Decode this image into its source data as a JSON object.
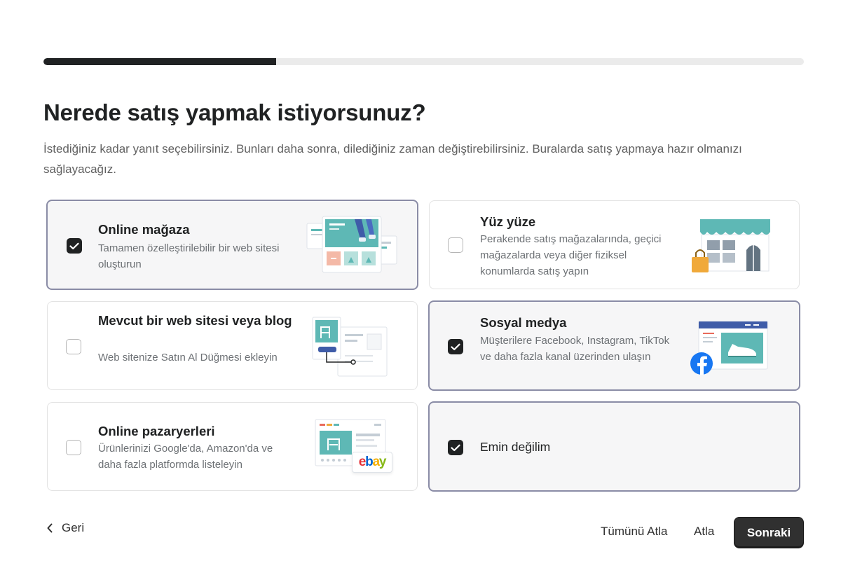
{
  "progress": {
    "fraction": 0.306
  },
  "header": {
    "title": "Nerede satış yapmak istiyorsunuz?",
    "subtitle": "İstediğiniz kadar yanıt seçebilirsiniz. Bunları daha sonra, dilediğiniz zaman değiştirebilirsiniz. Buralarda satış yapmaya hazır olmanızı sağlayacağız."
  },
  "options": {
    "online_store": {
      "title": "Online mağaza",
      "description": "Tamamen özelleştirilebilir bir web sitesi oluşturun",
      "selected": true,
      "icon": "online-store-illustration"
    },
    "in_person": {
      "title": "Yüz yüze",
      "description": "Perakende satış mağazalarında, geçici mağazalarda veya diğer fiziksel konumlarda satış yapın",
      "selected": false,
      "icon": "storefront-illustration"
    },
    "existing_site": {
      "title": "Mevcut bir web sitesi veya blog",
      "description": "Web sitenize Satın Al Düğmesi ekleyin",
      "selected": false,
      "icon": "buy-button-illustration"
    },
    "social_media": {
      "title": "Sosyal medya",
      "description": "Müşterilere Facebook, Instagram, TikTok ve daha fazla kanal üzerinden ulaşın",
      "selected": true,
      "icon": "facebook-shop-illustration"
    },
    "marketplaces": {
      "title": "Online pazaryerleri",
      "description": "Ürünlerinizi Google'da, Amazon'da ve daha fazla platformda listeleyin",
      "selected": false,
      "icon": "marketplace-illustration",
      "badge": "ebay"
    },
    "not_sure": {
      "title": "Emin değilim",
      "selected": true
    }
  },
  "footer": {
    "back_label": "Geri",
    "skip_all_label": "Tümünü Atla",
    "skip_label": "Atla",
    "next_label": "Sonraki"
  },
  "colors": {
    "primary": "#303030",
    "selected_border": "#8a8ca6",
    "selected_bg": "#f6f6f7",
    "teal": "#5eb8b5",
    "facebook": "#1877f2"
  }
}
